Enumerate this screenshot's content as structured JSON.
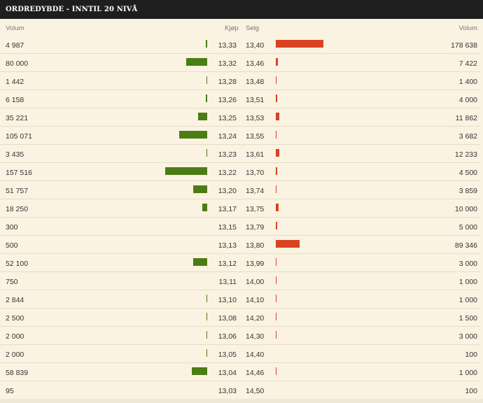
{
  "panel": {
    "title": "ORDREDYBDE - INNTIL 20 NIVÅ",
    "headers": {
      "buy_volume": "Volum",
      "buy_price": "Kjøp",
      "sell_price": "Selg",
      "sell_volume": "Volum"
    }
  },
  "colors": {
    "buy_bar": "#4c7c14",
    "sell_bar": "#d84321",
    "title_bg": "#1e1e1e",
    "panel_bg": "#fbf3e2"
  },
  "scale_max_volume": 178638,
  "rows": [
    {
      "buy_volume": "4 987",
      "buy_price": "13,33",
      "sell_price": "13,40",
      "sell_volume": "178 638",
      "bv": 4987,
      "sv": 178638
    },
    {
      "buy_volume": "80 000",
      "buy_price": "13,32",
      "sell_price": "13,46",
      "sell_volume": "7 422",
      "bv": 80000,
      "sv": 7422
    },
    {
      "buy_volume": "1 442",
      "buy_price": "13,28",
      "sell_price": "13,48",
      "sell_volume": "1 400",
      "bv": 1442,
      "sv": 1400
    },
    {
      "buy_volume": "6 158",
      "buy_price": "13,26",
      "sell_price": "13,51",
      "sell_volume": "4 000",
      "bv": 6158,
      "sv": 4000
    },
    {
      "buy_volume": "35 221",
      "buy_price": "13,25",
      "sell_price": "13,53",
      "sell_volume": "11 862",
      "bv": 35221,
      "sv": 11862
    },
    {
      "buy_volume": "105 071",
      "buy_price": "13,24",
      "sell_price": "13,55",
      "sell_volume": "3 682",
      "bv": 105071,
      "sv": 3682
    },
    {
      "buy_volume": "3 435",
      "buy_price": "13,23",
      "sell_price": "13,61",
      "sell_volume": "12 233",
      "bv": 3435,
      "sv": 12233
    },
    {
      "buy_volume": "157 516",
      "buy_price": "13,22",
      "sell_price": "13,70",
      "sell_volume": "4 500",
      "bv": 157516,
      "sv": 4500
    },
    {
      "buy_volume": "51 757",
      "buy_price": "13,20",
      "sell_price": "13,74",
      "sell_volume": "3 859",
      "bv": 51757,
      "sv": 3859
    },
    {
      "buy_volume": "18 250",
      "buy_price": "13,17",
      "sell_price": "13,75",
      "sell_volume": "10 000",
      "bv": 18250,
      "sv": 10000
    },
    {
      "buy_volume": "300",
      "buy_price": "13,15",
      "sell_price": "13,79",
      "sell_volume": "5 000",
      "bv": 300,
      "sv": 5000
    },
    {
      "buy_volume": "500",
      "buy_price": "13,13",
      "sell_price": "13,80",
      "sell_volume": "89 346",
      "bv": 500,
      "sv": 89346
    },
    {
      "buy_volume": "52 100",
      "buy_price": "13,12",
      "sell_price": "13,99",
      "sell_volume": "3 000",
      "bv": 52100,
      "sv": 3000
    },
    {
      "buy_volume": "750",
      "buy_price": "13,11",
      "sell_price": "14,00",
      "sell_volume": "1 000",
      "bv": 750,
      "sv": 1000
    },
    {
      "buy_volume": "2 844",
      "buy_price": "13,10",
      "sell_price": "14,10",
      "sell_volume": "1 000",
      "bv": 2844,
      "sv": 1000
    },
    {
      "buy_volume": "2 500",
      "buy_price": "13,08",
      "sell_price": "14,20",
      "sell_volume": "1 500",
      "bv": 2500,
      "sv": 1500
    },
    {
      "buy_volume": "2 000",
      "buy_price": "13,06",
      "sell_price": "14,30",
      "sell_volume": "3 000",
      "bv": 2000,
      "sv": 3000
    },
    {
      "buy_volume": "2 000",
      "buy_price": "13,05",
      "sell_price": "14,40",
      "sell_volume": "100",
      "bv": 2000,
      "sv": 100
    },
    {
      "buy_volume": "58 839",
      "buy_price": "13,04",
      "sell_price": "14,46",
      "sell_volume": "1 000",
      "bv": 58839,
      "sv": 1000
    },
    {
      "buy_volume": "95",
      "buy_price": "13,03",
      "sell_price": "14,50",
      "sell_volume": "100",
      "bv": 95,
      "sv": 100
    }
  ]
}
